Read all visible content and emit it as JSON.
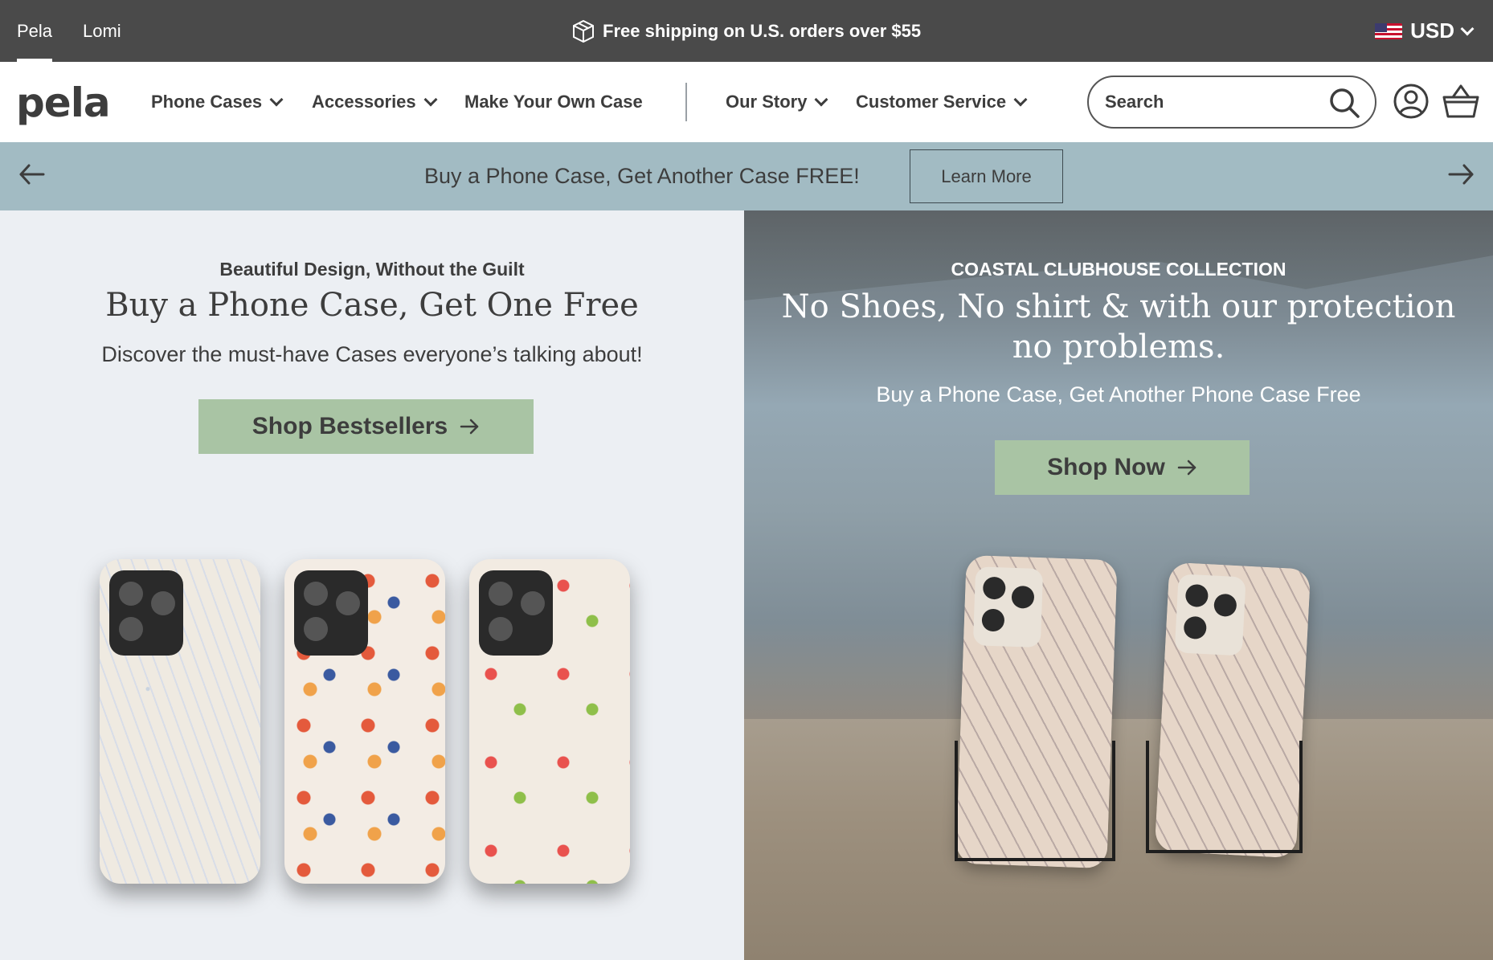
{
  "topbar": {
    "brands": [
      "Pela",
      "Lomi"
    ],
    "active_brand": "Pela",
    "shipping_message": "Free shipping on U.S. orders over $55",
    "currency": "USD"
  },
  "nav": {
    "logo": "pela",
    "items": [
      {
        "label": "Phone Cases",
        "dropdown": true
      },
      {
        "label": "Accessories",
        "dropdown": true
      },
      {
        "label": "Make Your Own Case",
        "dropdown": false
      },
      {
        "label": "Our Story",
        "dropdown": true
      },
      {
        "label": "Customer Service",
        "dropdown": true
      }
    ],
    "search_placeholder": "Search"
  },
  "promo": {
    "text": "Buy a Phone Case, Get Another Case FREE!",
    "button": "Learn More"
  },
  "hero_left": {
    "eyebrow": "Beautiful Design, Without the Guilt",
    "headline": "Buy a Phone Case, Get One Free",
    "subline": "Discover the must-have Cases everyone’s talking about!",
    "button": "Shop Bestsellers"
  },
  "hero_right": {
    "eyebrow": "COASTAL CLUBHOUSE COLLECTION",
    "headline": "No Shoes, No shirt & with our protection no problems.",
    "subline": "Buy a Phone Case, Get Another Phone Case Free",
    "button": "Shop Now"
  },
  "colors": {
    "topbar": "#4a4a4a",
    "promo_bar": "#a2bbc3",
    "cta_green": "#a9c4a4",
    "hero_left_bg": "#eceff3",
    "text": "#3d3d3d"
  },
  "icons": [
    "shipping-box-icon",
    "us-flag-icon",
    "chevron-down-icon",
    "search-icon",
    "account-icon",
    "cart-icon",
    "arrow-left-icon",
    "arrow-right-icon"
  ]
}
